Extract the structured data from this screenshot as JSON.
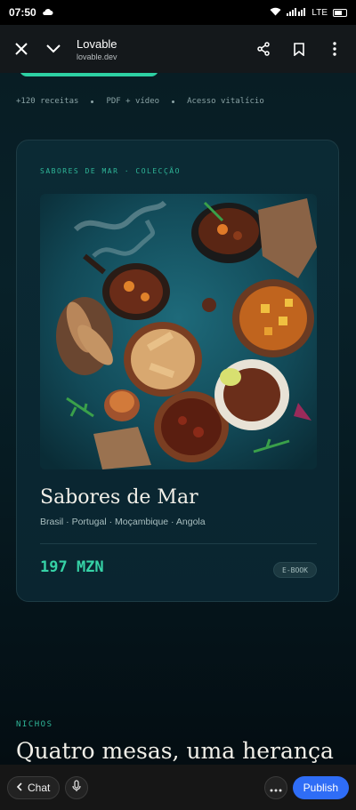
{
  "status_bar": {
    "time": "07:50",
    "signal_text": "LTE"
  },
  "browser": {
    "title": "Lovable",
    "url": "lovable.dev"
  },
  "page": {
    "meta": [
      "+120 receitas",
      "PDF + vídeo",
      "Acesso vitalício"
    ],
    "card": {
      "eyebrow": "SABORES DE MAR · COLECÇÃO",
      "name": "Sabores de Mar",
      "regions": "Brasil · Portugal · Moçambique · Angola",
      "price": "197 MZN",
      "badge": "E-BOOK"
    },
    "section": {
      "eyebrow": "NICHOS",
      "title": "Quatro mesas, uma herança"
    }
  },
  "bottom_bar": {
    "chat_label": "Chat",
    "publish_label": "Publish"
  },
  "colors": {
    "accent": "#2fb799",
    "price": "#36d2a6",
    "publish": "#2f6df6",
    "background": "#07161d"
  }
}
